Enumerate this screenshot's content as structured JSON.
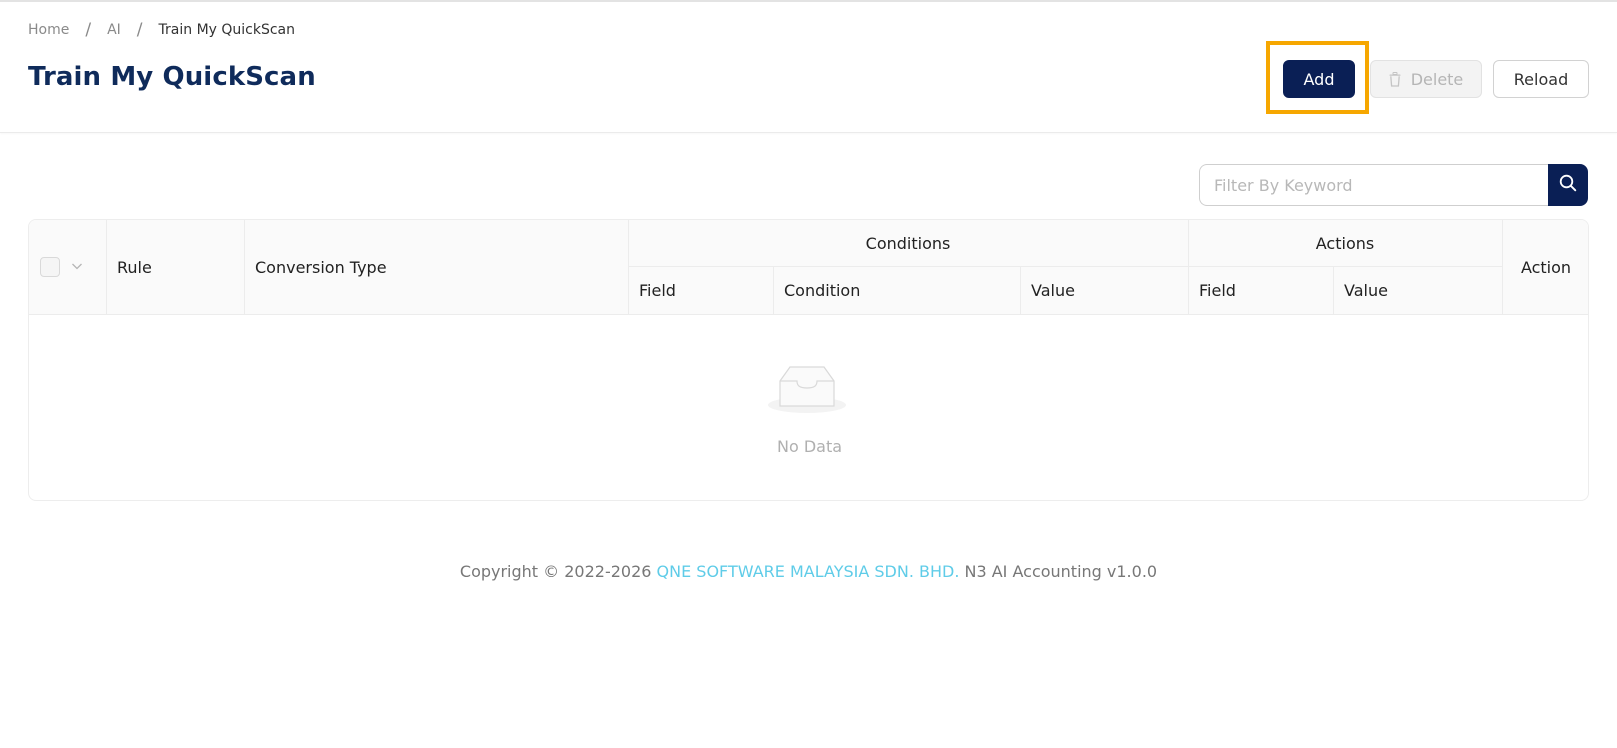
{
  "breadcrumb": [
    {
      "label": "Home"
    },
    {
      "label": "AI"
    },
    {
      "label": "Train My QuickScan"
    }
  ],
  "breadcrumb_separator": "/",
  "page_title": "Train My QuickScan",
  "toolbar": {
    "add_label": "Add",
    "delete_label": "Delete",
    "reload_label": "Reload"
  },
  "search": {
    "placeholder": "Filter By Keyword",
    "value": ""
  },
  "table": {
    "columns": {
      "rule": "Rule",
      "conversion_type": "Conversion Type",
      "conditions_group": "Conditions",
      "conditions_field": "Field",
      "conditions_condition": "Condition",
      "conditions_value": "Value",
      "actions_group": "Actions",
      "actions_field": "Field",
      "actions_value": "Value",
      "action": "Action"
    },
    "rows": [],
    "empty_text": "No Data"
  },
  "footer": {
    "prefix": "Copyright © 2022-2026 ",
    "company": "QNE SOFTWARE MALAYSIA SDN. BHD.",
    "suffix": " N3 AI Accounting v1.0.0"
  },
  "colors": {
    "primary": "#0a1f55",
    "title": "#0f2b5b",
    "highlight": "#f6a700",
    "link": "#5fcce8"
  },
  "icons": {
    "delete_icon": "trash-icon",
    "search_icon": "search-icon",
    "empty_icon": "inbox-icon",
    "select_chevron": "chevron-down-icon"
  }
}
